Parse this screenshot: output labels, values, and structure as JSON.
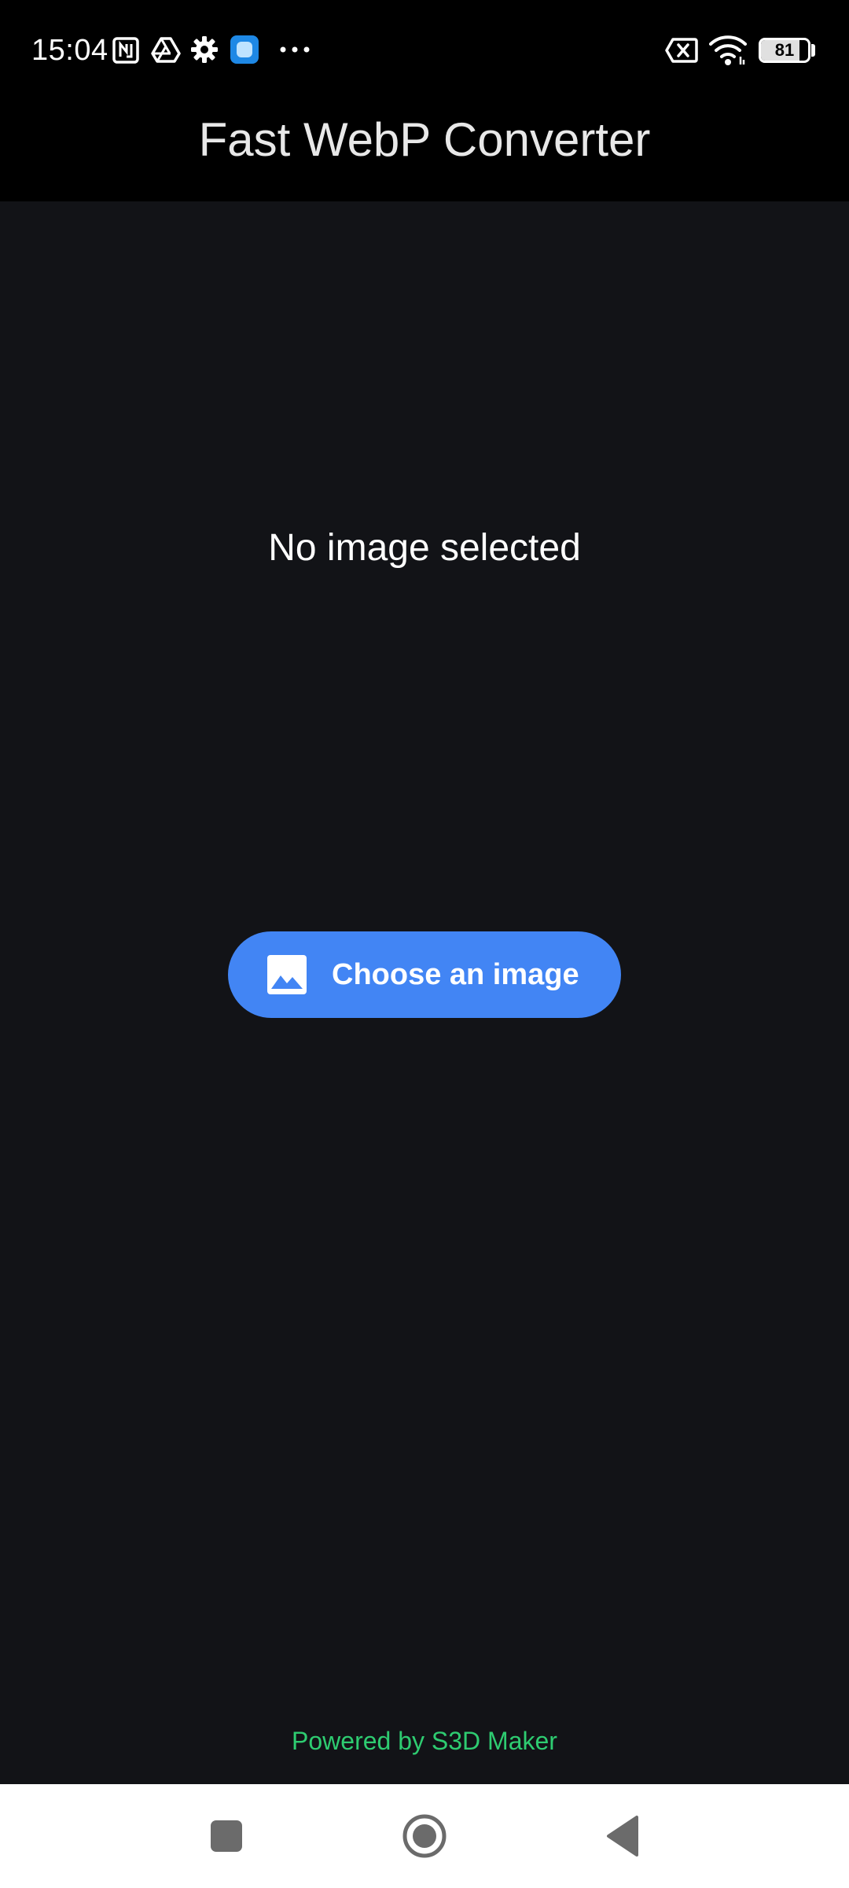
{
  "status_bar": {
    "time": "15:04",
    "battery_level": 81,
    "battery_label": "81",
    "icons": [
      "nfc-icon",
      "drive-icon",
      "settings-gear-icon",
      "app-notification-icon",
      "more-dots-icon",
      "no-sim-icon",
      "wifi-icon",
      "battery-icon"
    ]
  },
  "app_bar": {
    "title": "Fast WebP Converter"
  },
  "main": {
    "empty_state_text": "No image selected",
    "choose_button_label": "Choose an image",
    "choose_button_icon": "image-icon"
  },
  "footer": {
    "powered_by": "Powered by S3D Maker"
  },
  "navigation_bar": {
    "buttons": [
      "recents-square-icon",
      "home-circle-icon",
      "back-triangle-icon"
    ]
  },
  "colors": {
    "background": "#121317",
    "app_bar": "#000000",
    "accent_button": "#4285f4",
    "footer_text": "#2ecc71",
    "nav_bar": "#ffffff",
    "nav_icons": "#6b6b6b"
  }
}
